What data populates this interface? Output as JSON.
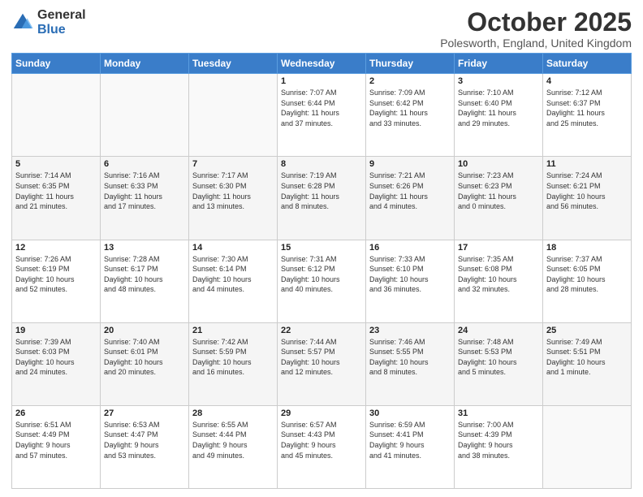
{
  "logo": {
    "general": "General",
    "blue": "Blue"
  },
  "title": "October 2025",
  "location": "Polesworth, England, United Kingdom",
  "days_of_week": [
    "Sunday",
    "Monday",
    "Tuesday",
    "Wednesday",
    "Thursday",
    "Friday",
    "Saturday"
  ],
  "weeks": [
    [
      {
        "day": "",
        "info": ""
      },
      {
        "day": "",
        "info": ""
      },
      {
        "day": "",
        "info": ""
      },
      {
        "day": "1",
        "info": "Sunrise: 7:07 AM\nSunset: 6:44 PM\nDaylight: 11 hours\nand 37 minutes."
      },
      {
        "day": "2",
        "info": "Sunrise: 7:09 AM\nSunset: 6:42 PM\nDaylight: 11 hours\nand 33 minutes."
      },
      {
        "day": "3",
        "info": "Sunrise: 7:10 AM\nSunset: 6:40 PM\nDaylight: 11 hours\nand 29 minutes."
      },
      {
        "day": "4",
        "info": "Sunrise: 7:12 AM\nSunset: 6:37 PM\nDaylight: 11 hours\nand 25 minutes."
      }
    ],
    [
      {
        "day": "5",
        "info": "Sunrise: 7:14 AM\nSunset: 6:35 PM\nDaylight: 11 hours\nand 21 minutes."
      },
      {
        "day": "6",
        "info": "Sunrise: 7:16 AM\nSunset: 6:33 PM\nDaylight: 11 hours\nand 17 minutes."
      },
      {
        "day": "7",
        "info": "Sunrise: 7:17 AM\nSunset: 6:30 PM\nDaylight: 11 hours\nand 13 minutes."
      },
      {
        "day": "8",
        "info": "Sunrise: 7:19 AM\nSunset: 6:28 PM\nDaylight: 11 hours\nand 8 minutes."
      },
      {
        "day": "9",
        "info": "Sunrise: 7:21 AM\nSunset: 6:26 PM\nDaylight: 11 hours\nand 4 minutes."
      },
      {
        "day": "10",
        "info": "Sunrise: 7:23 AM\nSunset: 6:23 PM\nDaylight: 11 hours\nand 0 minutes."
      },
      {
        "day": "11",
        "info": "Sunrise: 7:24 AM\nSunset: 6:21 PM\nDaylight: 10 hours\nand 56 minutes."
      }
    ],
    [
      {
        "day": "12",
        "info": "Sunrise: 7:26 AM\nSunset: 6:19 PM\nDaylight: 10 hours\nand 52 minutes."
      },
      {
        "day": "13",
        "info": "Sunrise: 7:28 AM\nSunset: 6:17 PM\nDaylight: 10 hours\nand 48 minutes."
      },
      {
        "day": "14",
        "info": "Sunrise: 7:30 AM\nSunset: 6:14 PM\nDaylight: 10 hours\nand 44 minutes."
      },
      {
        "day": "15",
        "info": "Sunrise: 7:31 AM\nSunset: 6:12 PM\nDaylight: 10 hours\nand 40 minutes."
      },
      {
        "day": "16",
        "info": "Sunrise: 7:33 AM\nSunset: 6:10 PM\nDaylight: 10 hours\nand 36 minutes."
      },
      {
        "day": "17",
        "info": "Sunrise: 7:35 AM\nSunset: 6:08 PM\nDaylight: 10 hours\nand 32 minutes."
      },
      {
        "day": "18",
        "info": "Sunrise: 7:37 AM\nSunset: 6:05 PM\nDaylight: 10 hours\nand 28 minutes."
      }
    ],
    [
      {
        "day": "19",
        "info": "Sunrise: 7:39 AM\nSunset: 6:03 PM\nDaylight: 10 hours\nand 24 minutes."
      },
      {
        "day": "20",
        "info": "Sunrise: 7:40 AM\nSunset: 6:01 PM\nDaylight: 10 hours\nand 20 minutes."
      },
      {
        "day": "21",
        "info": "Sunrise: 7:42 AM\nSunset: 5:59 PM\nDaylight: 10 hours\nand 16 minutes."
      },
      {
        "day": "22",
        "info": "Sunrise: 7:44 AM\nSunset: 5:57 PM\nDaylight: 10 hours\nand 12 minutes."
      },
      {
        "day": "23",
        "info": "Sunrise: 7:46 AM\nSunset: 5:55 PM\nDaylight: 10 hours\nand 8 minutes."
      },
      {
        "day": "24",
        "info": "Sunrise: 7:48 AM\nSunset: 5:53 PM\nDaylight: 10 hours\nand 5 minutes."
      },
      {
        "day": "25",
        "info": "Sunrise: 7:49 AM\nSunset: 5:51 PM\nDaylight: 10 hours\nand 1 minute."
      }
    ],
    [
      {
        "day": "26",
        "info": "Sunrise: 6:51 AM\nSunset: 4:49 PM\nDaylight: 9 hours\nand 57 minutes."
      },
      {
        "day": "27",
        "info": "Sunrise: 6:53 AM\nSunset: 4:47 PM\nDaylight: 9 hours\nand 53 minutes."
      },
      {
        "day": "28",
        "info": "Sunrise: 6:55 AM\nSunset: 4:44 PM\nDaylight: 9 hours\nand 49 minutes."
      },
      {
        "day": "29",
        "info": "Sunrise: 6:57 AM\nSunset: 4:43 PM\nDaylight: 9 hours\nand 45 minutes."
      },
      {
        "day": "30",
        "info": "Sunrise: 6:59 AM\nSunset: 4:41 PM\nDaylight: 9 hours\nand 41 minutes."
      },
      {
        "day": "31",
        "info": "Sunrise: 7:00 AM\nSunset: 4:39 PM\nDaylight: 9 hours\nand 38 minutes."
      },
      {
        "day": "",
        "info": ""
      }
    ]
  ]
}
